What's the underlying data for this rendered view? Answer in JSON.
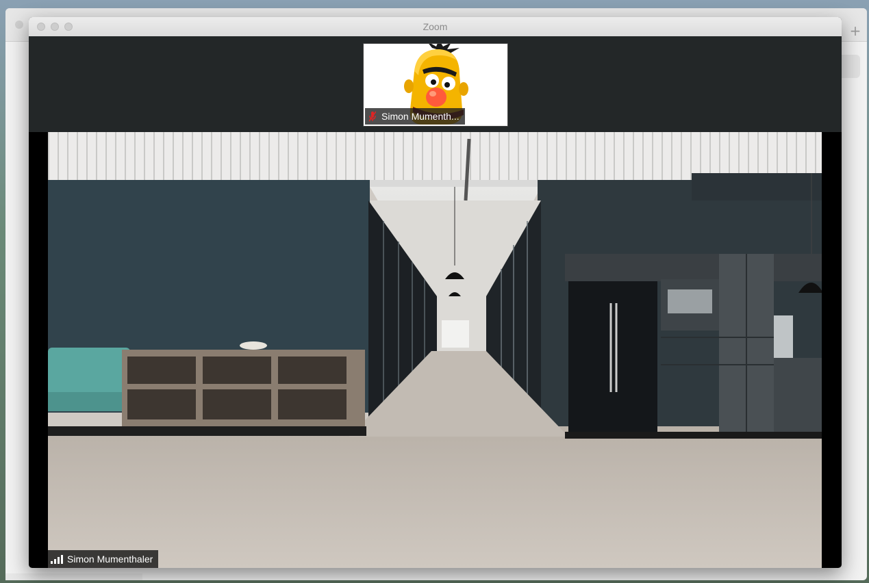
{
  "window": {
    "title": "Zoom"
  },
  "background_window": {
    "plus_glyph": "+"
  },
  "thumbnail": {
    "participant_name": "Simon Mumenth...",
    "icons": [
      "muted-mic-icon"
    ]
  },
  "active_speaker": {
    "participant_name": "Simon Mumenthaler",
    "icons": [
      "signal-strength-icon"
    ]
  },
  "colors": {
    "titlebar": "#e0e0e0",
    "strip": "#232728",
    "mute_red": "#e02424"
  }
}
